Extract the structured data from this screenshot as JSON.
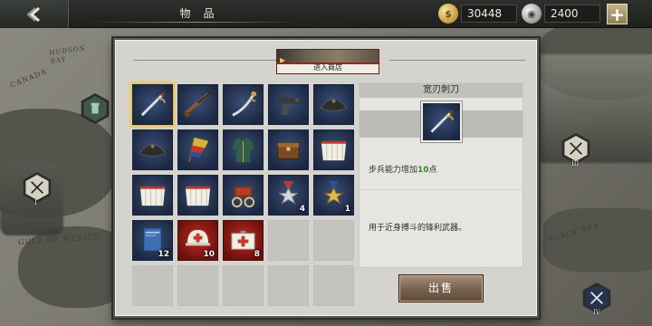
{
  "header": {
    "title": "物品",
    "gold": "30448",
    "silver": "2400",
    "back_icon": "chevron-left-icon",
    "add_icon": "plus-icon"
  },
  "map": {
    "labels": {
      "hudson": "HUDSON BAY",
      "canada": "CANADA",
      "gulf": "GULF OF MEXICO",
      "black_sea": "BLACK SEA"
    },
    "badges": [
      {
        "roman": "I",
        "icon": "crossed-sabers-icon"
      },
      {
        "roman": "III",
        "icon": "crossed-sabers-icon"
      },
      {
        "roman": "IV",
        "icon": "crossed-sabers-icon"
      }
    ]
  },
  "shop": {
    "label": "进入商店"
  },
  "inventory": {
    "items": [
      {
        "name": "sabre",
        "icon": "sabre-icon",
        "selected": true
      },
      {
        "name": "rifle",
        "icon": "rifle-icon"
      },
      {
        "name": "cavalry-sabre",
        "icon": "curved-sword-icon"
      },
      {
        "name": "pistol",
        "icon": "pistol-icon"
      },
      {
        "name": "hat",
        "icon": "bicorne-hat-icon"
      },
      {
        "name": "hat-2",
        "icon": "bicorne-hat-icon"
      },
      {
        "name": "flags",
        "icon": "flags-icon"
      },
      {
        "name": "uniform",
        "icon": "uniform-icon"
      },
      {
        "name": "ammo-box",
        "icon": "ammo-box-icon"
      },
      {
        "name": "tent",
        "icon": "tent-icon"
      },
      {
        "name": "tent-2",
        "icon": "tent-icon"
      },
      {
        "name": "tent-3",
        "icon": "tent-icon"
      },
      {
        "name": "wagon",
        "icon": "wagon-icon"
      },
      {
        "name": "silver-medal",
        "icon": "medal-icon",
        "qty": "4"
      },
      {
        "name": "gold-medal",
        "icon": "medal-icon",
        "qty": "1"
      },
      {
        "name": "manual",
        "icon": "book-icon",
        "qty": "12"
      },
      {
        "name": "medic-helmet",
        "icon": "medic-helmet-icon",
        "qty": "10"
      },
      {
        "name": "medkit",
        "icon": "medkit-icon",
        "qty": "8"
      }
    ]
  },
  "detail": {
    "name": "宽刃刺刀",
    "icon": "sabre-icon",
    "effect_prefix": "步兵能力增加",
    "effect_value": "10",
    "effect_suffix": "点",
    "description": "用于近身搏斗的锋利武器。"
  },
  "actions": {
    "sell_label": "出售"
  },
  "colors": {
    "accent_gold": "#e8c860",
    "effect_green": "#2f8a2a",
    "item_bg": "#1c2841",
    "red_item_bg": "#6a100c"
  }
}
